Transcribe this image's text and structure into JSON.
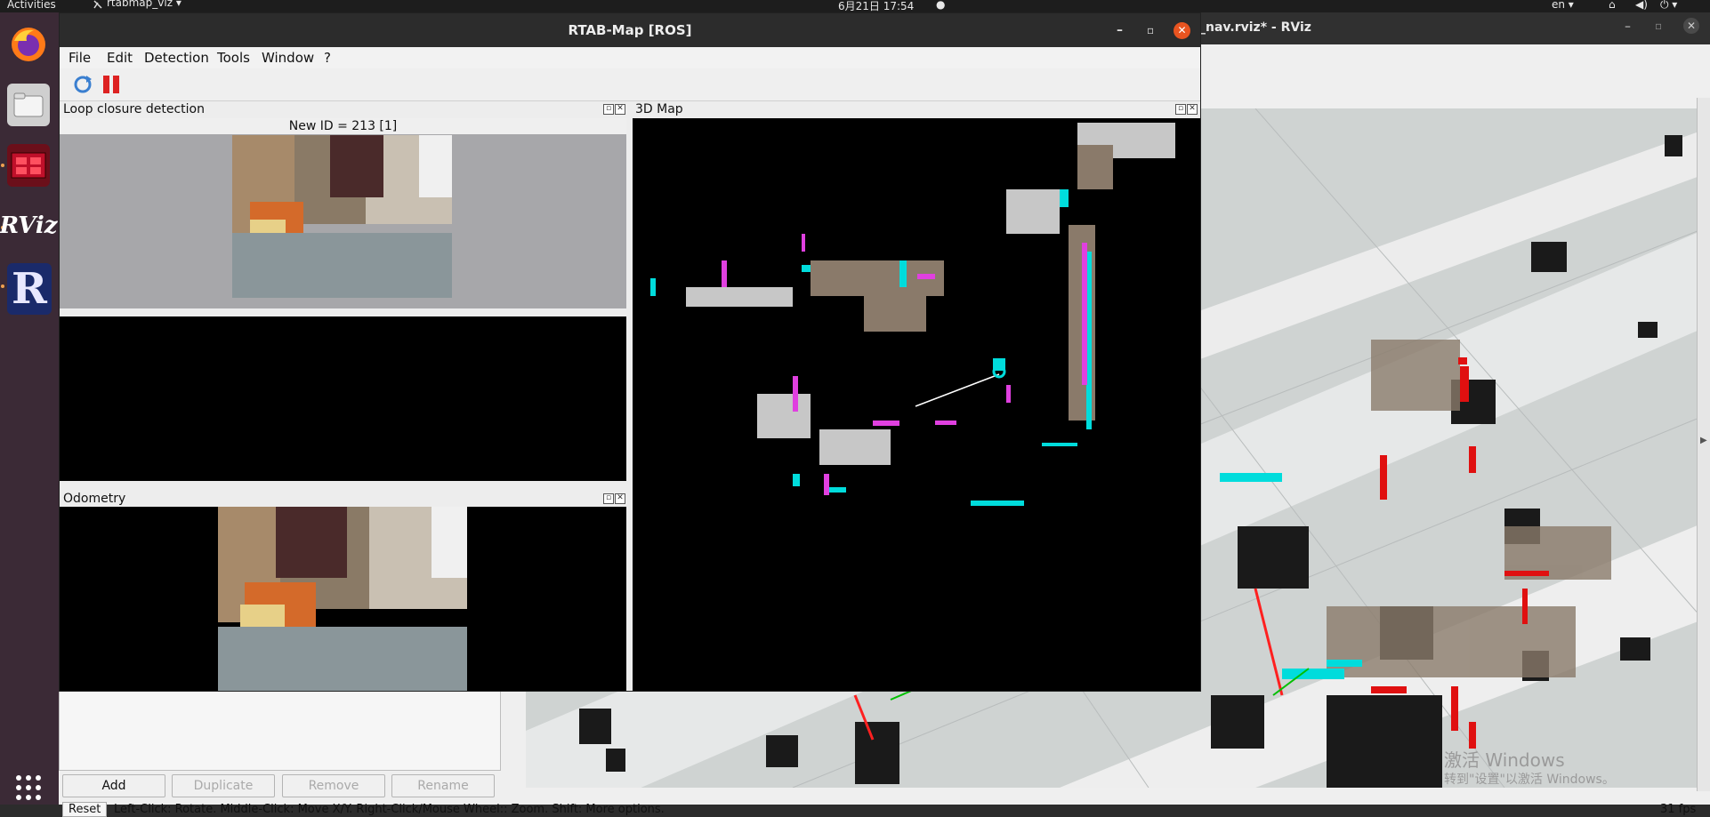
{
  "topbar": {
    "activities": "Activities",
    "app_menu": "rtabmap_viz ▾",
    "datetime": "6月21日  17:54",
    "language": "en ▾"
  },
  "dock": {
    "items": [
      {
        "name": "firefox"
      },
      {
        "name": "files"
      },
      {
        "name": "app-red"
      },
      {
        "name": "rviz",
        "label": "RViz"
      },
      {
        "name": "rtabmap",
        "label": "R"
      }
    ]
  },
  "rviz": {
    "title": "_nav.rviz* - RViz",
    "buttons": {
      "add": "Add",
      "duplicate": "Duplicate",
      "remove": "Remove",
      "rename": "Rename"
    },
    "status": {
      "reset": "Reset",
      "hint_prefix": "Left-Click:",
      "hint_text": "Left-Click: Rotate. Middle-Click: Move X/Y. Right-Click/Mouse Wheel:: Zoom. Shift: More options.",
      "fps": "31 fps"
    },
    "watermark": {
      "line1": "激活 Windows",
      "line2": "转到\"设置\"以激活 Windows。"
    }
  },
  "rtabmap": {
    "title": "RTAB-Map [ROS]",
    "menu": [
      "File",
      "Edit",
      "Detection",
      "Tools",
      "Window",
      "?"
    ],
    "loop_closure": {
      "title": "Loop closure detection",
      "new_id": "New ID = 213 [1]"
    },
    "odometry": {
      "title": "Odometry"
    },
    "map3d": {
      "title": "3D Map"
    }
  },
  "colors": {
    "topbar": "#1d1d1d",
    "dock": "#3b2a36",
    "accent_close": "#e95420",
    "map_cyan": "#00e5e5",
    "map_magenta": "#e040e0",
    "rviz_red": "#e01010"
  }
}
